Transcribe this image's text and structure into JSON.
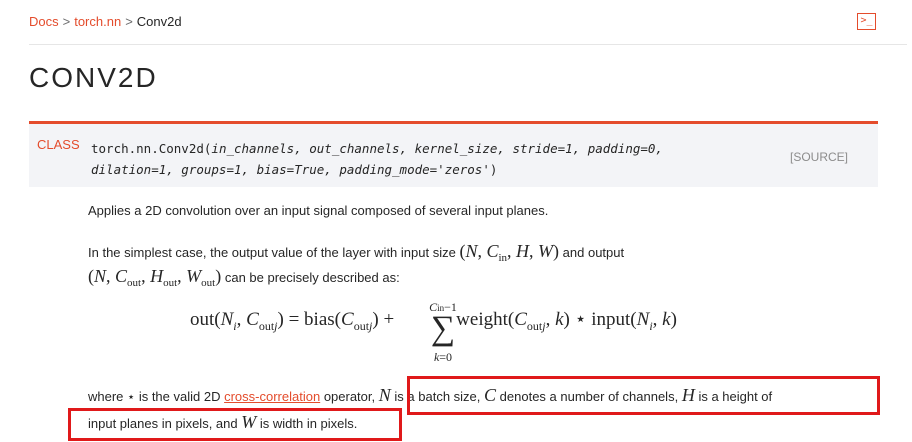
{
  "breadcrumb": {
    "docs": "Docs",
    "separator": ">",
    "module": "torch.nn",
    "current": "Conv2d"
  },
  "toolbar": {
    "shortcut_icon": "terminal-shortcut-icon",
    "shortcut_glyph": ">_"
  },
  "page": {
    "title": "CONV2D"
  },
  "signature": {
    "class_label": "CLASS",
    "name": "torch.nn.Conv2d(",
    "params_line1": "in_channels, out_channels, kernel_size, stride=1, padding=0,",
    "params_line2": "dilation=1, groups=1, bias=True, padding_mode='zeros'",
    "close_paren": ")",
    "source_link": "[SOURCE]"
  },
  "description": {
    "p1": "Applies a 2D convolution over an input signal composed of several input planes.",
    "p2_start": "In the simplest case, the output value of the layer with input size",
    "p2_mid": "and output",
    "p2_end": "can be precisely described as:",
    "p3_where": "where",
    "p3_star_desc": "is the valid 2D",
    "p3_link": "cross-correlation",
    "p3_op": "operator,",
    "p3_n": "is a batch size,",
    "p3_c": "denotes a number of channels,",
    "p3_h": "is a height of",
    "p4_start": "input planes in pixels, and",
    "p4_w": "is width in pixels."
  },
  "colors": {
    "accent": "#e44c2c",
    "highlight_box": "#e0191a",
    "signature_bg": "#f3f4f7"
  }
}
